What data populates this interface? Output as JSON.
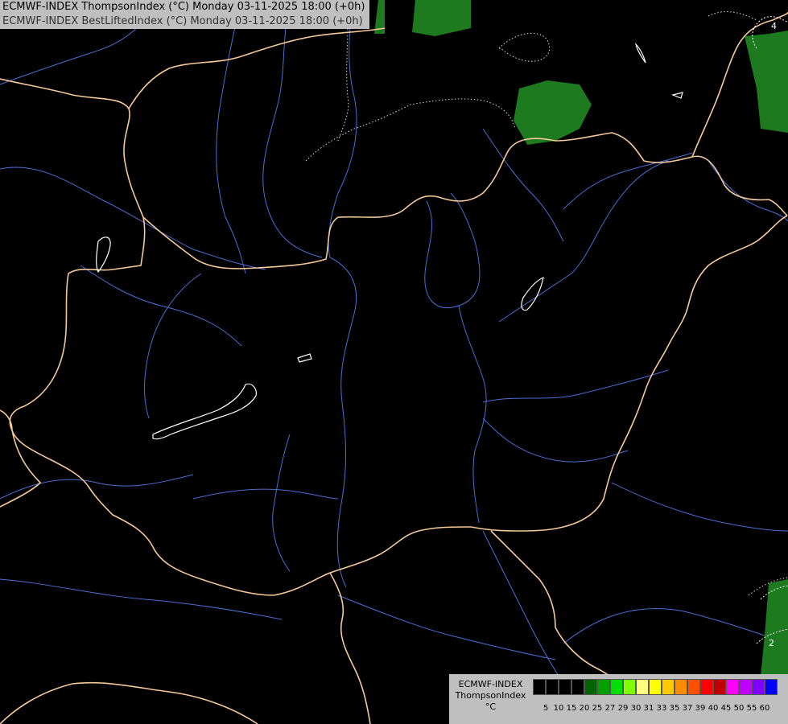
{
  "header": {
    "line1": "ECMWF-INDEX ThompsonIndex (°C) Monday 03-11-2025 18:00 (+0h)",
    "line2": "ECMWF-INDEX BestLiftedIndex (°C) Monday 03-11-2025 18:00 (+0h)"
  },
  "map": {
    "background": "#000000",
    "border_color": "#f5c99a",
    "river_color": "#4a6fd6",
    "contour_color": "#ffffff",
    "contour_labels": [
      "4",
      "2"
    ]
  },
  "legend": {
    "model": "ECMWF-INDEX",
    "field": "ThompsonIndex",
    "unit": "°C",
    "colors": [
      "#000000",
      "#000000",
      "#000000",
      "#000000",
      "#006400",
      "#00a000",
      "#00e000",
      "#80ff00",
      "#ffff80",
      "#ffff00",
      "#ffc800",
      "#ff8c00",
      "#ff5000",
      "#ff0000",
      "#c00000",
      "#ff00ff",
      "#c000ff",
      "#8000ff",
      "#0000ff"
    ],
    "ticks": [
      "5",
      "10",
      "15",
      "20",
      "25",
      "27",
      "29",
      "30",
      "31",
      "33",
      "35",
      "37",
      "39",
      "40",
      "45",
      "50",
      "55",
      "60"
    ]
  }
}
